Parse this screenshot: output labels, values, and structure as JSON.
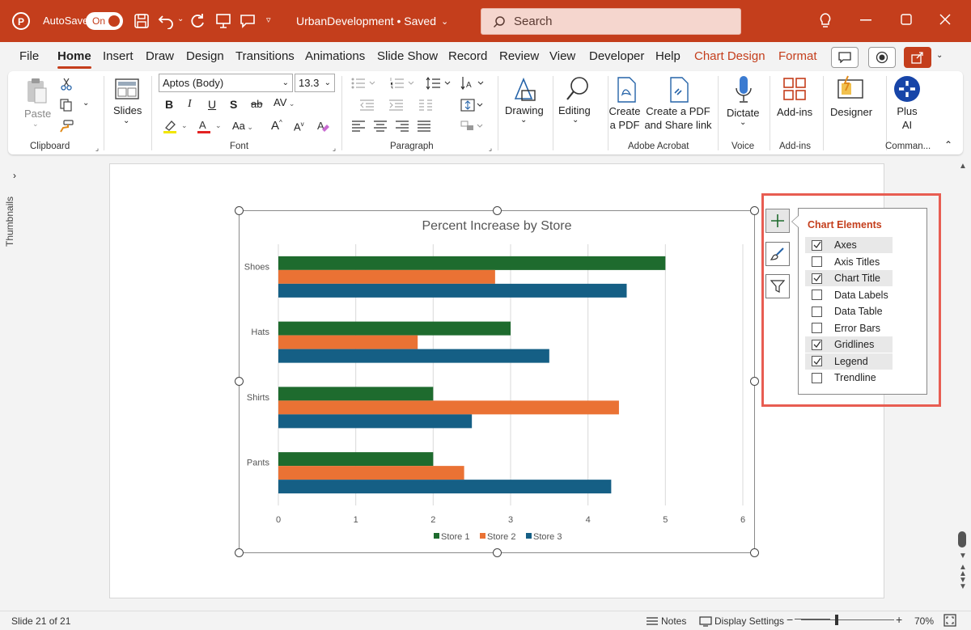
{
  "titlebar": {
    "autosave_label": "AutoSave",
    "autosave_state": "On",
    "doc_title": "UrbanDevelopment • Saved",
    "search_placeholder": "Search"
  },
  "menu": {
    "tabs": [
      {
        "label": "File"
      },
      {
        "label": "Home"
      },
      {
        "label": "Insert"
      },
      {
        "label": "Draw"
      },
      {
        "label": "Design"
      },
      {
        "label": "Transitions"
      },
      {
        "label": "Animations"
      },
      {
        "label": "Slide Show"
      },
      {
        "label": "Record"
      },
      {
        "label": "Review"
      },
      {
        "label": "View"
      },
      {
        "label": "Developer"
      },
      {
        "label": "Help"
      },
      {
        "label": "Chart Design"
      },
      {
        "label": "Format"
      }
    ],
    "active": "Home"
  },
  "ribbon": {
    "clipboard": {
      "paste": "Paste",
      "label": "Clipboard"
    },
    "slides": {
      "label": "Slides"
    },
    "font": {
      "name": "Aptos (Body)",
      "size": "13.3",
      "label": "Font",
      "bold": "B",
      "italic": "I",
      "underline": "U",
      "shadow": "S",
      "strike": "ab",
      "spacing": "AV",
      "case": "Aa",
      "grow": "A",
      "shrink": "A"
    },
    "paragraph": {
      "label": "Paragraph"
    },
    "drawing": {
      "label": "Drawing"
    },
    "editing": {
      "label": "Editing"
    },
    "acrobat": {
      "create_pdf_1": "Create",
      "create_pdf_2": "a PDF",
      "share_1": "Create a PDF",
      "share_2": "and Share link",
      "label": "Adobe Acrobat"
    },
    "voice": {
      "dictate": "Dictate",
      "label": "Voice"
    },
    "addins": {
      "button": "Add-ins",
      "label": "Add-ins"
    },
    "designer": {
      "button": "Designer"
    },
    "plusai": {
      "line1": "Plus",
      "line2": "AI",
      "label": "Comman..."
    }
  },
  "left_pane": {
    "label": "Thumbnails"
  },
  "chart_data": {
    "type": "bar",
    "orientation": "horizontal",
    "title": "Percent Increase by Store",
    "categories": [
      "Pants",
      "Shirts",
      "Hats",
      "Shoes"
    ],
    "series": [
      {
        "name": "Store 1",
        "color": "#1e6b2e",
        "values": [
          2,
          2,
          3,
          5
        ]
      },
      {
        "name": "Store 2",
        "color": "#ea7234",
        "values": [
          2.4,
          4.4,
          1.8,
          2.8
        ]
      },
      {
        "name": "Store 3",
        "color": "#155f85",
        "values": [
          4.3,
          2.5,
          3.5,
          4.5
        ]
      }
    ],
    "xlim": [
      0,
      6
    ],
    "xticks": [
      "0",
      "1",
      "2",
      "3",
      "4",
      "5",
      "6"
    ],
    "grid": true,
    "legend": "bottom"
  },
  "chart_elements": {
    "title": "Chart Elements",
    "items": [
      {
        "label": "Axes",
        "checked": true
      },
      {
        "label": "Axis Titles",
        "checked": false
      },
      {
        "label": "Chart Title",
        "checked": true
      },
      {
        "label": "Data Labels",
        "checked": false
      },
      {
        "label": "Data Table",
        "checked": false
      },
      {
        "label": "Error Bars",
        "checked": false
      },
      {
        "label": "Gridlines",
        "checked": true
      },
      {
        "label": "Legend",
        "checked": true
      },
      {
        "label": "Trendline",
        "checked": false
      }
    ]
  },
  "statusbar": {
    "slide": "Slide 21 of 21",
    "notes": "Notes",
    "display": "Display Settings",
    "minus": "−",
    "plus": "+",
    "zoom": "70%"
  },
  "colors": {
    "accent": "#c43e1c",
    "highlight": "#e85d52"
  }
}
